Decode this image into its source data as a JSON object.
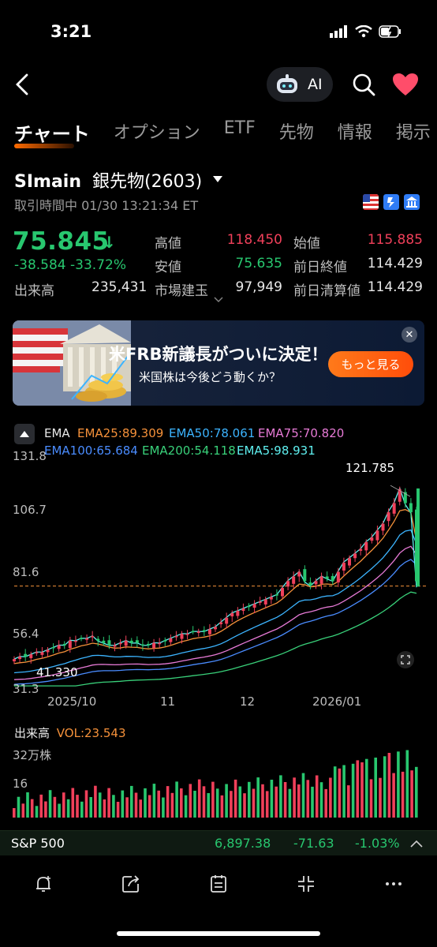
{
  "status": {
    "time": "3:21"
  },
  "header": {
    "ai_label": "AI"
  },
  "tabs": [
    "チャート",
    "オプション",
    "ETF",
    "先物",
    "情報",
    "掲示"
  ],
  "symbol": {
    "code": "SImain",
    "name": "銀先物(2603)",
    "session": "取引時間中 01/30 13:21:34 ET"
  },
  "quote": {
    "price": "75.845",
    "change": "-38.584",
    "change_pct": "-33.72%",
    "volume_label": "出来高",
    "volume": "235,431",
    "high_label": "高値",
    "high": "118.450",
    "low_label": "安値",
    "low": "75.635",
    "oi_label": "市場建玉",
    "oi": "97,949",
    "open_label": "始値",
    "open": "115.885",
    "prev_close_label": "前日終値",
    "prev_close": "114.429",
    "prev_settle_label": "前日清算値",
    "prev_settle": "114.429"
  },
  "banner": {
    "title": "米FRB新議長がついに決定！",
    "subtitle": "米国株は今後どう動くか？",
    "cta": "もっと見る"
  },
  "ema": {
    "label": "EMA",
    "items": [
      {
        "text": "EMA25:89.309",
        "color": "#f5913a"
      },
      {
        "text": "EMA50:78.061",
        "color": "#3cb4ff"
      },
      {
        "text": "EMA75:70.820",
        "color": "#e77ad6"
      },
      {
        "text": "EMA100:65.684",
        "color": "#4a8cff"
      },
      {
        "text": "EMA200:54.118",
        "color": "#39d17a"
      },
      {
        "text": "EMA5:98.931",
        "color": "#5ff0f0"
      }
    ]
  },
  "chart_data": {
    "type": "candlestick",
    "y_ticks": [
      "131.8",
      "106.7",
      "81.6",
      "56.4",
      "31.3"
    ],
    "ylim": [
      31.3,
      131.8
    ],
    "x_ticks": [
      "2025/10",
      "11",
      "12",
      "2026/01"
    ],
    "high_marker": "121.785",
    "low_marker": "41.330",
    "last_price": 75.845,
    "close_path": [
      44,
      45,
      45,
      46,
      47,
      47,
      48,
      49,
      50,
      50,
      52,
      52,
      53,
      53,
      54,
      52,
      51,
      50,
      50,
      51,
      52,
      51,
      51,
      50,
      50,
      51,
      51,
      52,
      53,
      54,
      55,
      55,
      56,
      56,
      56,
      57,
      58,
      60,
      62,
      64,
      65,
      66,
      67,
      68,
      69,
      70,
      71,
      72,
      75,
      78,
      80,
      82,
      78,
      76,
      78,
      80,
      79,
      78,
      82,
      86,
      88,
      90,
      92,
      95,
      97,
      100,
      103,
      108,
      112,
      118,
      112,
      108,
      78
    ]
  },
  "volume": {
    "label": "出来高",
    "vol_text": "VOL:23.543",
    "y_top": "32万株",
    "y_mid": "16"
  },
  "ticker": {
    "name": "S&P 500",
    "value": "6,897.38",
    "change": "-71.63",
    "pct": "-1.03%"
  },
  "toolbar": [
    "alert-icon",
    "share-icon",
    "notes-icon",
    "fullscreen-icon",
    "more-icon"
  ]
}
